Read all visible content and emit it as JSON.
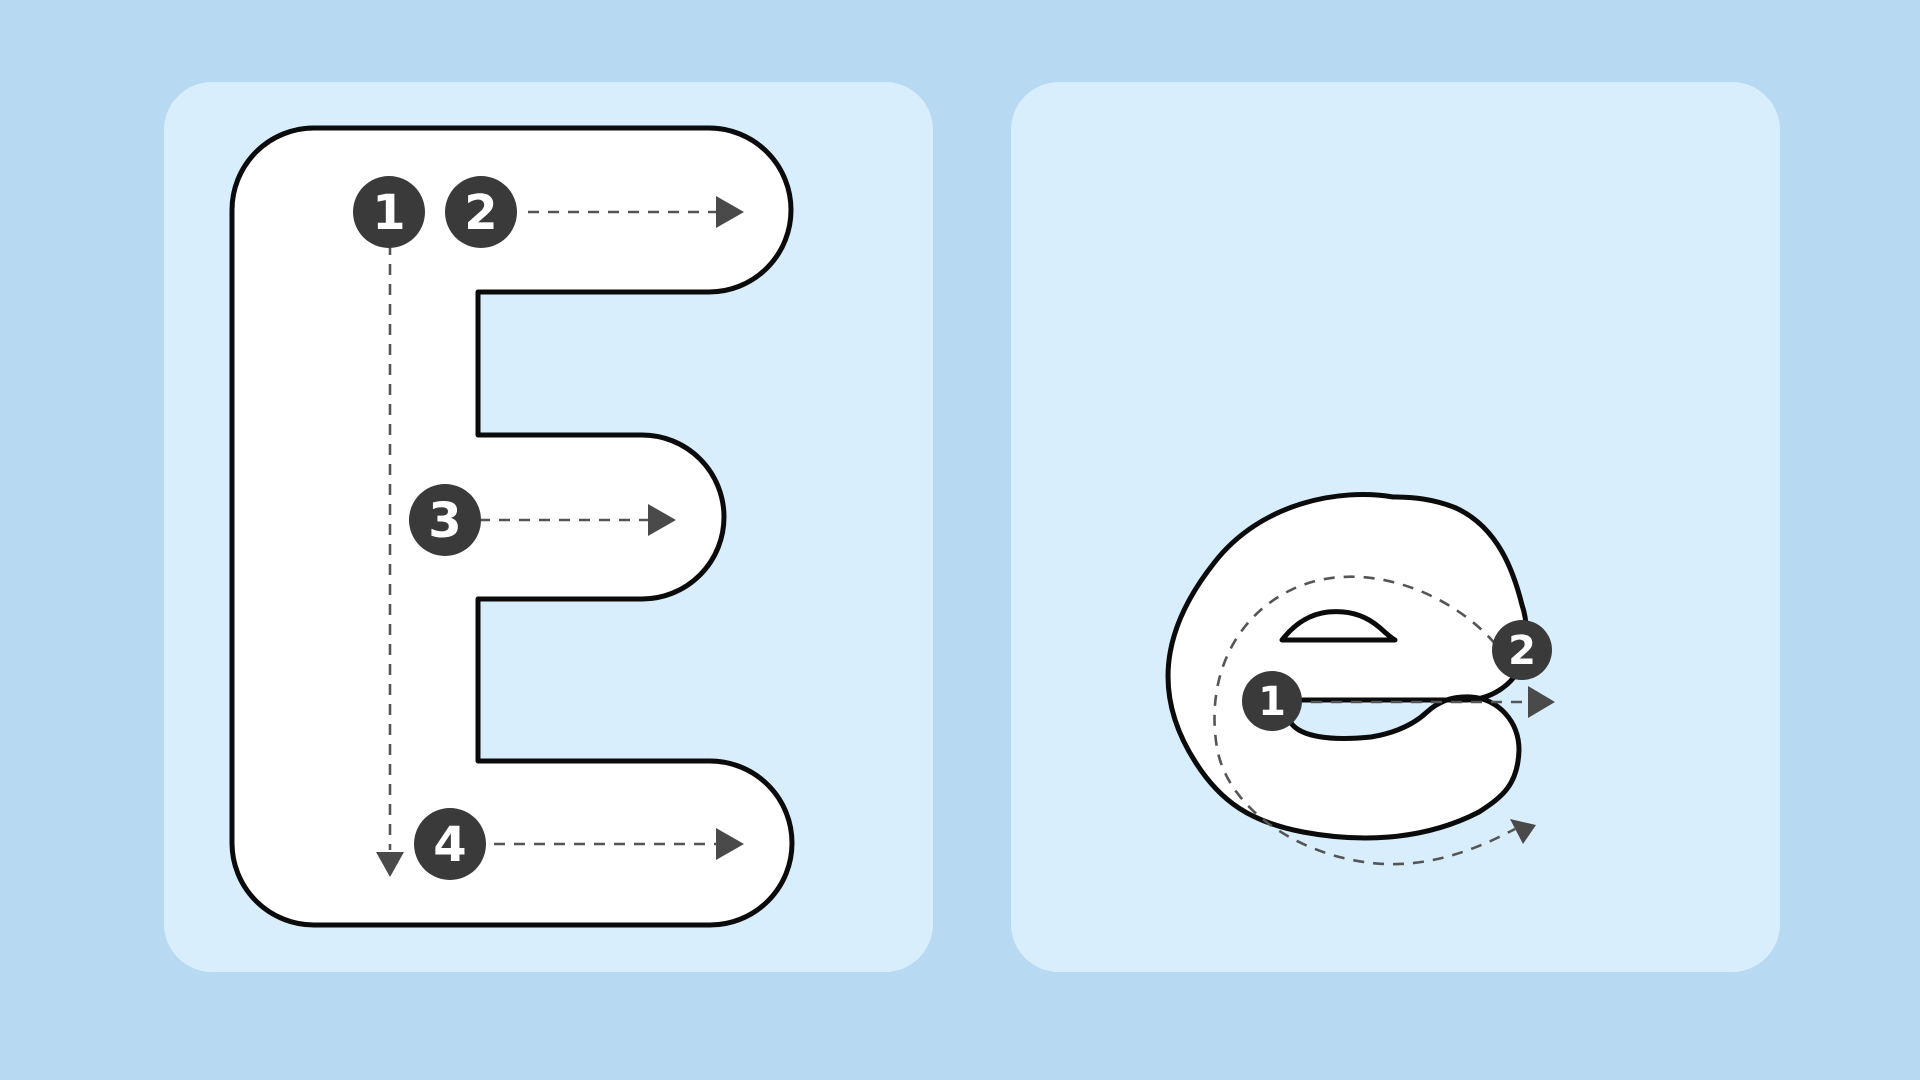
{
  "colors": {
    "background": "#b7d9f2",
    "card": "#d9eefc",
    "letter_fill": "#ffffff",
    "outline": "#0b0b0b",
    "badge": "#3a3a3a",
    "guide": "#555555"
  },
  "uppercase_card": {
    "letter_glyph": "E",
    "strokes": [
      {
        "number": "1",
        "direction": "down"
      },
      {
        "number": "2",
        "direction": "right"
      },
      {
        "number": "3",
        "direction": "right"
      },
      {
        "number": "4",
        "direction": "right"
      }
    ]
  },
  "lowercase_card": {
    "letter_glyph": "e",
    "strokes": [
      {
        "number": "1",
        "direction": "right"
      },
      {
        "number": "2",
        "direction": "counter-clockwise"
      }
    ]
  }
}
